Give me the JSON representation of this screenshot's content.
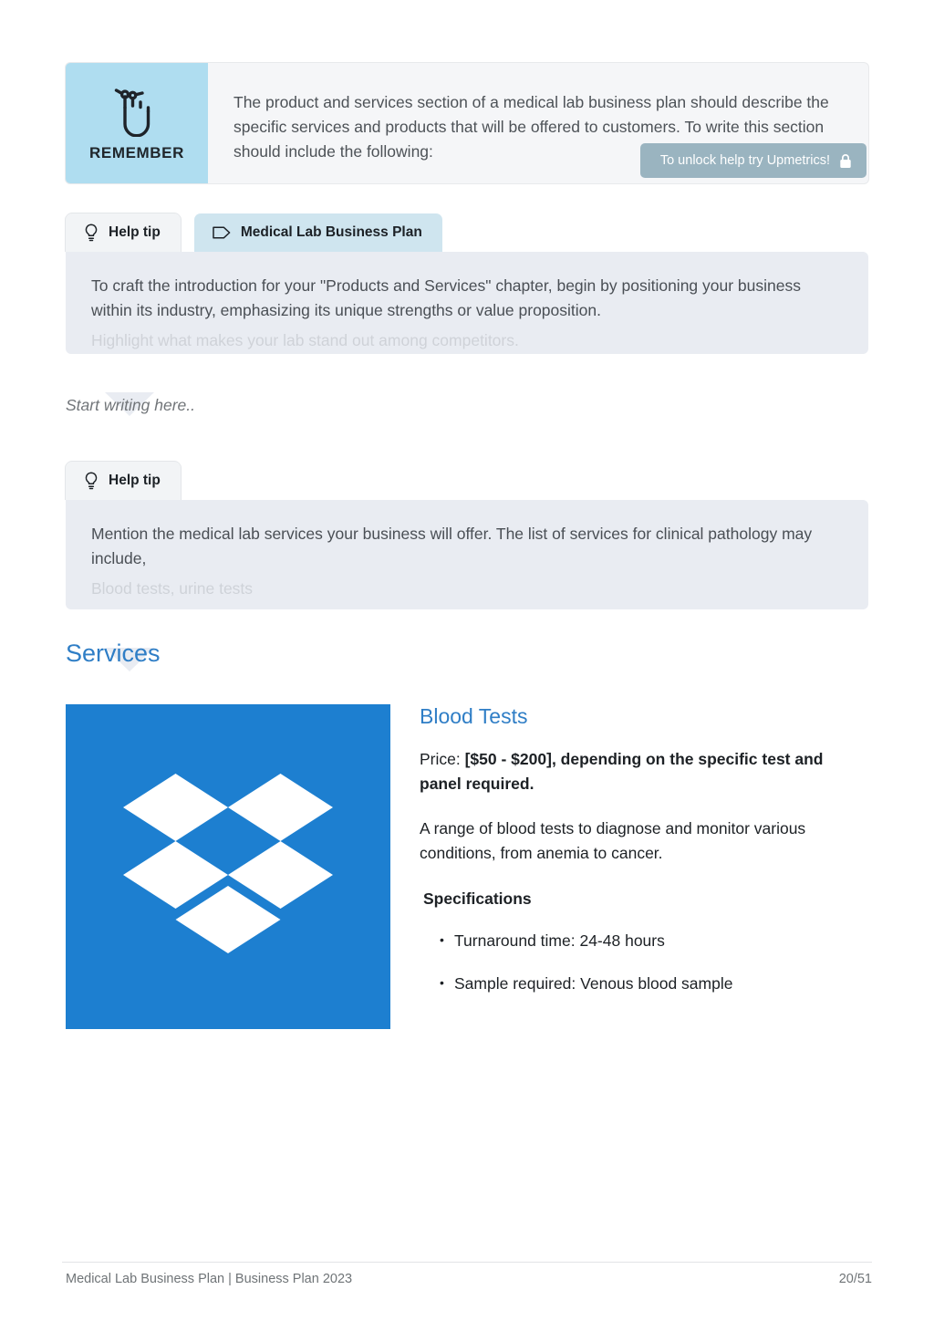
{
  "remember": {
    "icon": "hand-with-string-icon",
    "label": "REMEMBER",
    "text": "The product and services section of a medical lab business plan should describe the specific services and products that will be offered to customers. To write this section should include the following:"
  },
  "unlock_badge": {
    "text": "To unlock help try Upmetrics!",
    "icon": "lock-icon",
    "background": "#9ab4c0"
  },
  "tip_one": {
    "tabs": [
      {
        "label": "Help tip",
        "icon": "lightbulb-icon",
        "active": false
      },
      {
        "label": "Medical Lab Business Plan",
        "icon": "tag-icon",
        "active": true
      }
    ],
    "text": "To craft the introduction for your \"Products and Services\" chapter, begin by positioning your business within its industry, emphasizing its unique strengths or value proposition.",
    "clipped_text": "Highlight what makes your lab stand out among competitors."
  },
  "start_writing": {
    "placeholder": "Start writing here.."
  },
  "tip_two": {
    "tabs": [
      {
        "label": "Help tip",
        "icon": "lightbulb-icon",
        "active": false
      }
    ],
    "text": "Mention the medical lab services your business will offer. The list of services for clinical pathology may include,",
    "clipped_text": "Blood tests, urine tests"
  },
  "services": {
    "heading": "Services",
    "card": {
      "image_alt": "dropbox-logo",
      "image_background": "#1d7fd0",
      "title": "Blood Tests",
      "price_label": "Price:",
      "price_value": "[$50 - $200], depending on the specific test and panel required.",
      "description": "A range of blood tests to diagnose and monitor various conditions, from anemia to cancer.",
      "spec_heading": "Specifications",
      "specs": [
        "Turnaround time: 24-48 hours",
        "Sample required: Venous blood sample"
      ]
    }
  },
  "footer": {
    "left": "Medical Lab Business Plan | Business Plan 2023",
    "right": "20/51"
  },
  "theme": {
    "accent_blue": "#2f7ec6",
    "remember_panel": "#afddf0",
    "tip_body": "#e9ecf2",
    "active_tab": "#cfe5ef"
  }
}
